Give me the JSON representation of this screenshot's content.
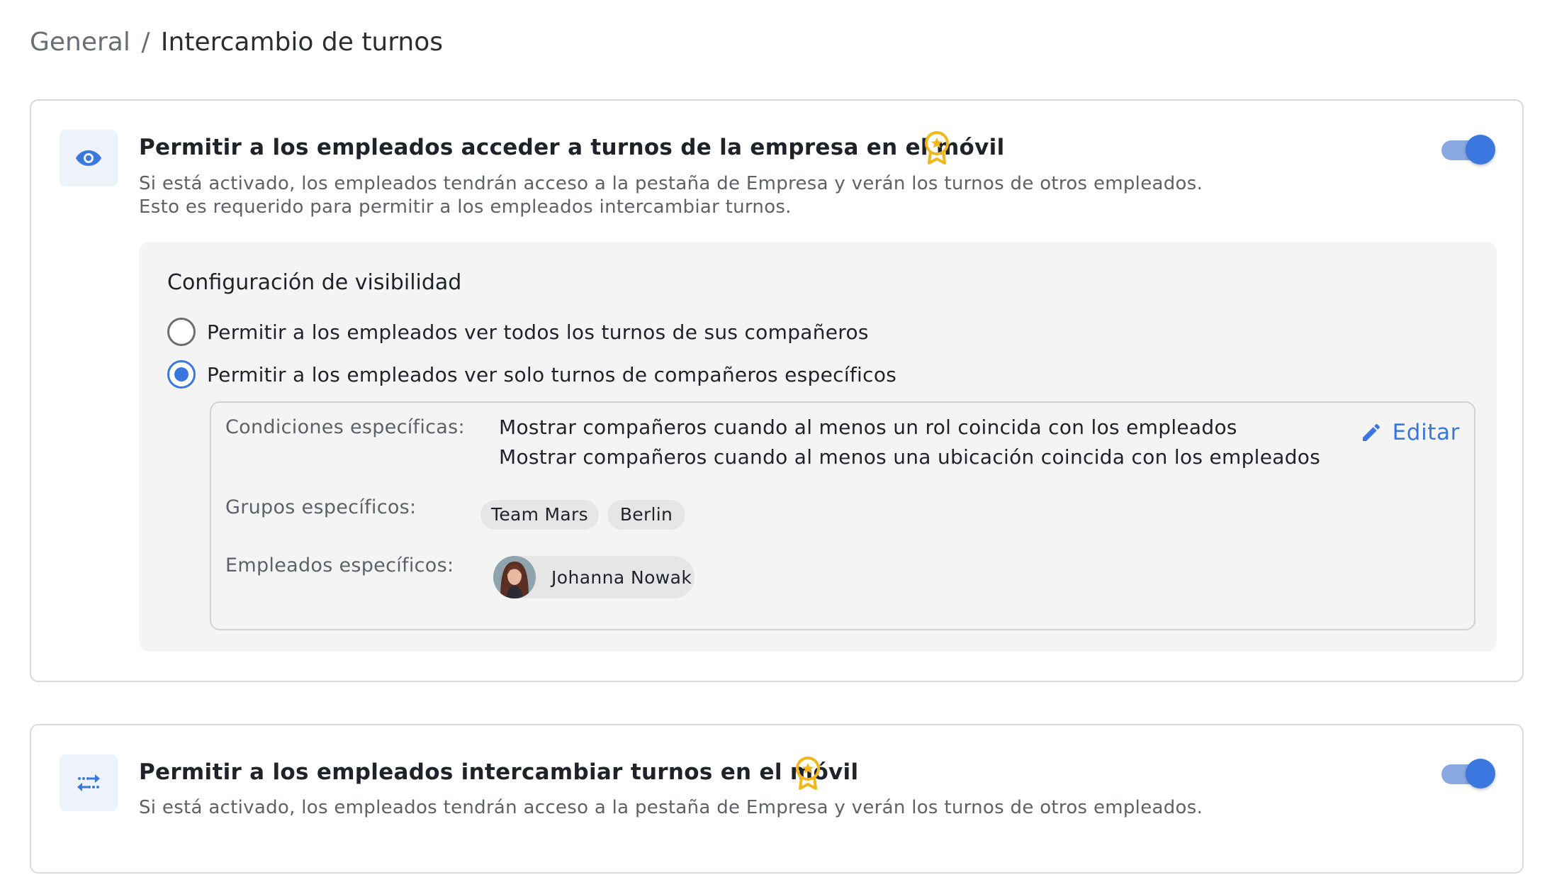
{
  "breadcrumb": {
    "parent": "General",
    "separator": "/",
    "current": "Intercambio de turnos"
  },
  "settings": [
    {
      "title": "Permitir a los empleados acceder a turnos de la empresa en el móvil",
      "icon": "eye-icon",
      "premium": true,
      "enabled": true,
      "description_lines": [
        "Si está activado, los empleados tendrán acceso a la pestaña de Empresa y verán los turnos de otros empleados.",
        "Esto es requerido para permitir a los empleados intercambiar turnos."
      ]
    },
    {
      "title": "Permitir a los empleados intercambiar turnos en el móvil",
      "icon": "swap-arrows-icon",
      "premium": true,
      "enabled": true,
      "description_lines": [
        "Si está activado, los empleados tendrán acceso a la pestaña de Empresa y verán los turnos de otros empleados."
      ]
    }
  ],
  "visibility": {
    "title": "Configuración de visibilidad",
    "options": [
      {
        "label": "Permitir a los empleados ver todos los turnos de sus compañeros",
        "selected": false
      },
      {
        "label": "Permitir a los empleados ver solo turnos de compañeros específicos",
        "selected": true
      }
    ],
    "specific": {
      "conditions_label": "Condiciones específicas:",
      "conditions": [
        "Mostrar compañeros cuando al menos un rol coincida con los empleados",
        "Mostrar compañeros cuando al menos una ubicación coincida con los empleados"
      ],
      "edit_label": "Editar",
      "groups_label": "Grupos específicos:",
      "groups": [
        "Team Mars",
        "Berlin"
      ],
      "employees_label": "Empleados específicos:",
      "employees": [
        {
          "name": "Johanna Nowak"
        }
      ]
    }
  },
  "colors": {
    "accent": "#3a78e0",
    "premium": "#f2b81b",
    "icon_bg": "#eef2fb",
    "panel_bg": "#f4f4f4"
  }
}
